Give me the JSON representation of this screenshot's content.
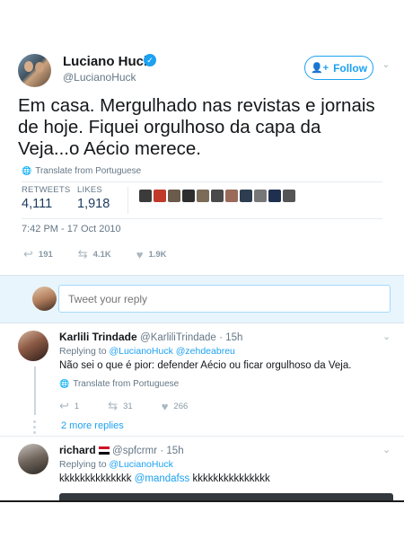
{
  "colors": {
    "accent": "#1da1f2",
    "muted": "#657786",
    "composer_bg": "#e8f5fd"
  },
  "main_tweet": {
    "author_name": "Luciano Huck",
    "author_handle": "@LucianoHuck",
    "verified_icon": "verified-badge-icon",
    "follow_label": "Follow",
    "follow_icon": "add-user-icon",
    "text": "Em casa. Mergulhado nas revistas e jornais de hoje. Fiquei orgulhoso da capa da Veja...o Aécio merece.",
    "translate_label": "Translate from Portuguese",
    "stats": {
      "retweets_label": "RETWEETS",
      "retweets_value": "4,111",
      "likes_label": "LIKES",
      "likes_value": "1,918"
    },
    "timestamp": "7:42 PM - 17 Oct 2010",
    "actions": {
      "reply_count": "191",
      "retweet_count": "4.1K",
      "like_count": "1.9K"
    },
    "liker_avatar_colors": [
      "#3b3b3b",
      "#c0392b",
      "#6b5b4a",
      "#2e2e2e",
      "#7b6b58",
      "#4a4a4a",
      "#9a6a5a",
      "#2c3e50",
      "#777777",
      "#1f2f4f",
      "#555555"
    ]
  },
  "composer": {
    "placeholder": "Tweet your reply"
  },
  "replies": [
    {
      "name": "Karlili Trindade",
      "handle": "@KarliliTrindade",
      "time": "· 15h",
      "replying_prefix": "Replying to",
      "replying_to_1": "@LucianoHuck",
      "replying_to_2": "@zehdeabreu",
      "text": "Não sei o que é pior: defender Aécio ou ficar orgulhoso da Veja.",
      "translate_label": "Translate from Portuguese",
      "reply_count": "1",
      "retweet_count": "31",
      "like_count": "266",
      "more_replies": "2 more replies"
    },
    {
      "name": "richard",
      "handle": "@spfcrmr",
      "time": "· 15h",
      "replying_prefix": "Replying to",
      "replying_to_1": "@LucianoHuck",
      "text_before": "kkkkkkkkkkkkkk",
      "mention": "@mandafss",
      "text_after": "kkkkkkkkkkkkkkk"
    }
  ]
}
